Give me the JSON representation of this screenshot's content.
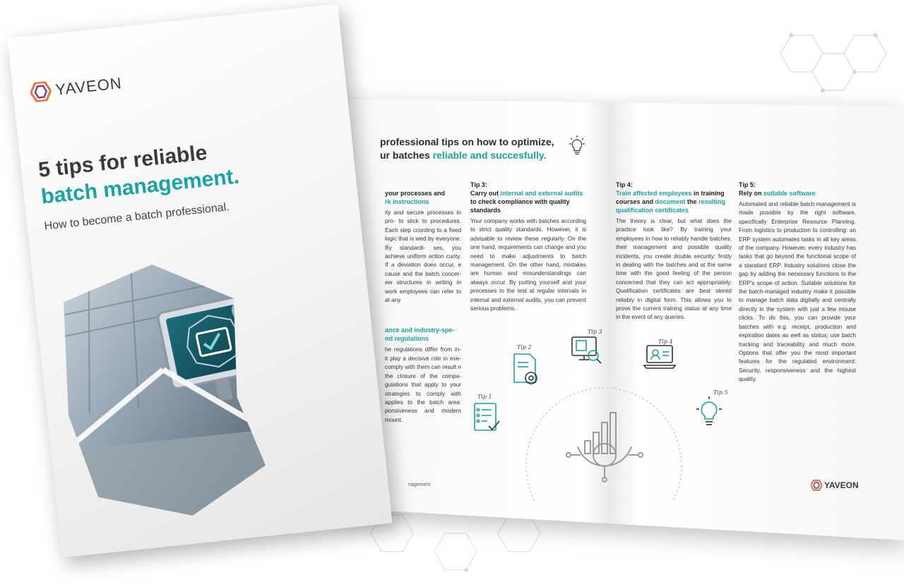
{
  "cover": {
    "brand": "YAVEON",
    "title_line1": "5 tips for reliable",
    "title_line2": "batch management.",
    "subtitle": "How to become a batch professional."
  },
  "spread": {
    "header_line1": "professional tips on how to optimize,",
    "header_line2_plain": "ur batches ",
    "header_line2_accent": "reliable and succesfully.",
    "footer_label": "nagement",
    "brand": "YAVEON"
  },
  "partial_col1": {
    "title_a": "your processes and",
    "title_b": "rk instructions",
    "body": "ity and secure processes in pro- to stick to procedures. Each step ccording to a fixed logic that is wed by everyone. By standardi- ses, you achieve uniform action curity. If a deviation does occur, e cause and the batch concer- ew structures in writing in work employees can refer to at any",
    "title2_a": "ance and industry-spe-",
    "title2_b": "nd regulations",
    "body2": "he regulations differ from in- it play a decisive role in eve- comply with them can result n the closure of the compa- gulations that apply to your strategies to comply with applies to the batch area: ponsiveness and modern mount."
  },
  "tips": [
    {
      "num": "3",
      "label": "Tip 3:",
      "title_pre": "Carry out ",
      "title_accent": "internal and external audits",
      "title_post": " to check compliance with quality standards",
      "body": "Your company works with batches according to strict quality standards. However, it is advisable to review these regularly. On the one hand, requirements can change and you need to make adjustments to batch management. On the other hand, mistakes are human and misunderstandings can always occur. By putting yourself and your processes to the test at regular intervals in internal and external audits, you can prevent serious problems."
    },
    {
      "num": "4",
      "label": "Tip 4:",
      "title_pre": "",
      "title_accent": "Train affected employees",
      "title_post": " in training courses and ",
      "title_accent2": "document",
      "title_post2": " the ",
      "title_accent3": "resulting qualification certificates",
      "body": "The theory is clear, but what does the practice look like? By training your employees in how to reliably handle batches, their management and possible quality incidents, you create double security: firstly in dealing with the batches and at the same time with the good feeling of the person concerned that they can act appropriately. Qualification certificates are best stored reliably in digital form. This allows you to prove the current training status at any time in the event of any queries."
    },
    {
      "num": "5",
      "label": "Tip 5:",
      "title_pre": "Rely on ",
      "title_accent": "suitable software",
      "title_post": "",
      "body": "Automated and reliable batch management is made possible by the right software, specifically Enterprise Resource Planning. From logistics to production to controlling: an ERP system automates tasks in all key areas of the company. However, every industry has tasks that go beyond the functional scope of a standard ERP. Industry solutions close the gap by adding the necessary functions to the ERP's scope of action. Suitable solutions for the batch-managed industry make it possible to manage batch data digitally and centrally directly in the system with just a few mouse clicks. To do this, you can provide your batches with e.g. receipt, production and expiration dates as well as status, use batch tracking and traceability and much more. Options that offer you the most important features for the regulated environment: Security, responsiveness and the highest quality."
    }
  ],
  "diagram_labels": [
    "Tip 1",
    "Tip 2",
    "Tip 3",
    "Tip 4",
    "Tip 5"
  ],
  "colors": {
    "accent": "#1aa3a3",
    "brand_orange": "#e8743b",
    "brand_purple": "#7b3f8c",
    "text": "#333333"
  },
  "icons": [
    "bulb-icon",
    "checklist-icon",
    "document-gear-icon",
    "monitor-search-icon",
    "laptop-person-icon",
    "lightbulb-gear-icon",
    "chart-gear-icon",
    "checkmark-screen-icon"
  ]
}
